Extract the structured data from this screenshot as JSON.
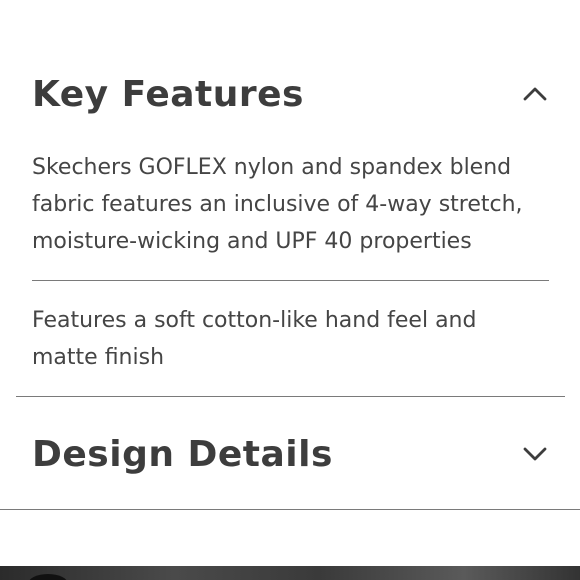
{
  "sections": [
    {
      "title": "Key Features",
      "expanded": true,
      "toggle_icon": "chevron-up-icon",
      "items": [
        "Skechers GOFLEX nylon and spandex blend fabric features an inclusive of 4-way stretch, moisture-wicking and UPF 40 properties",
        "Features a soft cotton-like hand feel and matte finish"
      ]
    },
    {
      "title": "Design Details",
      "expanded": false,
      "toggle_icon": "chevron-down-icon"
    }
  ],
  "colors": {
    "text": "#3d3d3d",
    "divider": "#7a7a7a",
    "background": "#ffffff"
  }
}
